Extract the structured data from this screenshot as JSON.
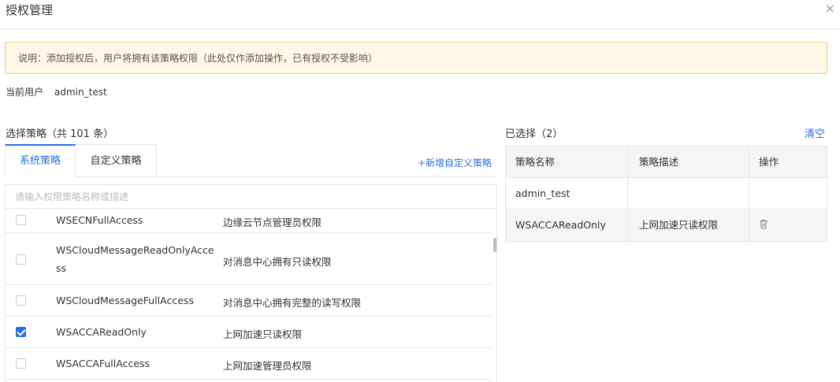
{
  "dialog": {
    "title": "授权管理",
    "close_icon": "×"
  },
  "notice": "说明：添加授权后，用户将拥有该策略权限（此处仅作添加操作，已有授权不受影响）",
  "current_user": {
    "label": "当前用户",
    "value": "admin_test"
  },
  "policy_select": {
    "title": "选择策略（共 101 条）",
    "tabs": [
      "系统策略",
      "自定义策略"
    ],
    "add_custom": "+新增自定义策略",
    "search_placeholder": "请输入权限策略名称或描述",
    "rows": [
      {
        "name": "WSECNFullAccess",
        "desc": "边缘云节点管理员权限",
        "checked": false
      },
      {
        "name": "WSCloudMessageReadOnlyAccess",
        "desc": "对消息中心拥有只读权限",
        "checked": false
      },
      {
        "name": "WSCloudMessageFullAccess",
        "desc": "对消息中心拥有完整的读写权限",
        "checked": false
      },
      {
        "name": "WSACCAReadOnly",
        "desc": "上网加速只读权限",
        "checked": true
      },
      {
        "name": "WSACCAFullAccess",
        "desc": "上网加速管理员权限",
        "checked": false
      }
    ]
  },
  "selected": {
    "title": "已选择（2）",
    "clear": "清空",
    "columns": [
      "策略名称",
      "策略描述",
      "操作"
    ],
    "rows": [
      {
        "name": "admin_test",
        "desc": "",
        "deletable": false
      },
      {
        "name": "WSACCAReadOnly",
        "desc": "上网加速只读权限",
        "deletable": true
      }
    ]
  },
  "colors": {
    "accent": "#2a6fe8",
    "notice_bg": "#fff7e6",
    "notice_border": "#f5c77e"
  }
}
